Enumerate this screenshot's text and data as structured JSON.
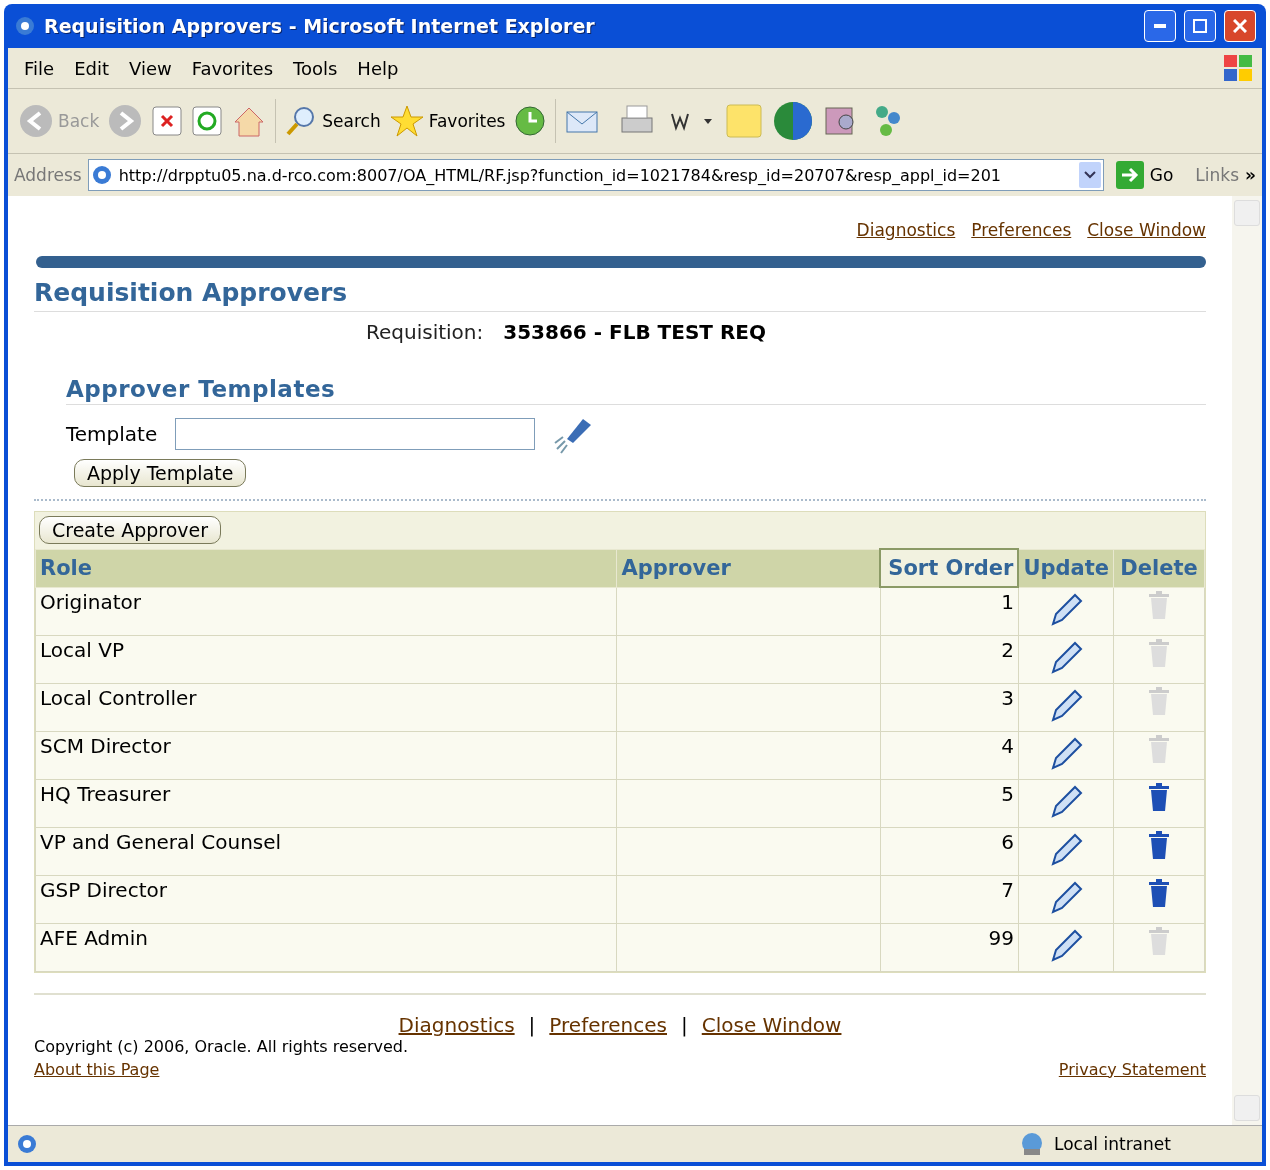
{
  "window": {
    "title": "Requisition Approvers - Microsoft Internet Explorer"
  },
  "menu": [
    "File",
    "Edit",
    "View",
    "Favorites",
    "Tools",
    "Help"
  ],
  "toolbar": {
    "back": "Back",
    "search": "Search",
    "favorites": "Favorites"
  },
  "address": {
    "label": "Address",
    "url": "http://drpptu05.na.d-rco.com:8007/OA_HTML/RF.jsp?function_id=1021784&resp_id=20707&resp_appl_id=201",
    "go": "Go",
    "links": "Links",
    "more": "»"
  },
  "global_links": [
    "Diagnostics",
    "Preferences",
    "Close Window"
  ],
  "page_title": "Requisition Approvers",
  "requisition": {
    "label": "Requisition:",
    "value": "353866 - FLB TEST REQ"
  },
  "templates": {
    "title": "Approver Templates",
    "field_label": "Template",
    "apply": "Apply Template"
  },
  "create_button": "Create Approver",
  "table": {
    "columns": [
      "Role",
      "Approver",
      "Sort Order",
      "Update",
      "Delete"
    ],
    "rows": [
      {
        "role": "Originator",
        "sort": "1",
        "delete_enabled": false
      },
      {
        "role": "Local VP",
        "sort": "2",
        "delete_enabled": false
      },
      {
        "role": "Local Controller",
        "sort": "3",
        "delete_enabled": false
      },
      {
        "role": "SCM Director",
        "sort": "4",
        "delete_enabled": false
      },
      {
        "role": "HQ Treasurer",
        "sort": "5",
        "delete_enabled": true
      },
      {
        "role": "VP and General Counsel",
        "sort": "6",
        "delete_enabled": true
      },
      {
        "role": "GSP Director",
        "sort": "7",
        "delete_enabled": true
      },
      {
        "role": "AFE Admin",
        "sort": "99",
        "delete_enabled": false
      }
    ]
  },
  "footer": {
    "links": [
      "Diagnostics",
      "Preferences",
      "Close Window"
    ],
    "separator": "|",
    "copyright": "Copyright (c) 2006, Oracle. All rights reserved.",
    "about": "About this Page",
    "privacy": "Privacy Statement"
  },
  "status_bar": {
    "zone": "Local intranet"
  }
}
